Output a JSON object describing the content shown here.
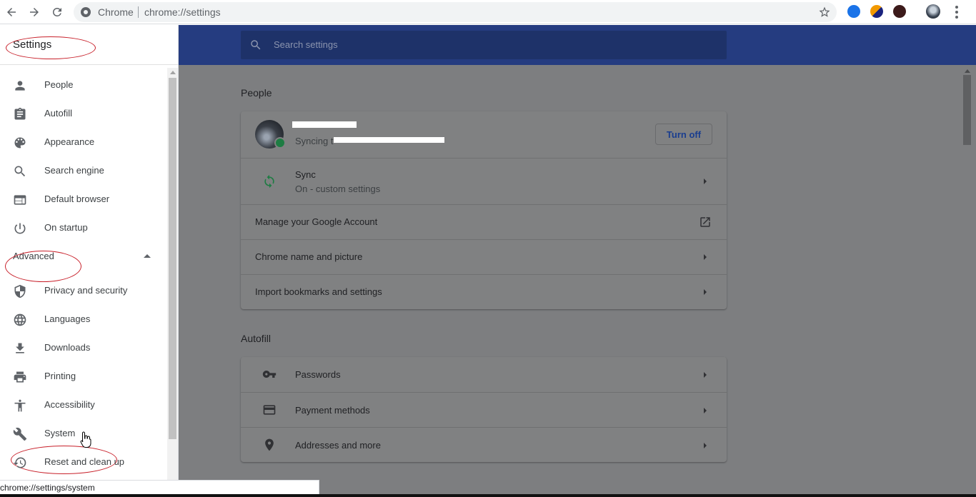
{
  "browser": {
    "site_label": "Chrome",
    "url": "chrome://settings",
    "status_url": "chrome://settings/system",
    "icons": [
      "back-icon",
      "forward-icon",
      "reload-icon",
      "star-icon",
      "menu-icon"
    ]
  },
  "sidebar": {
    "title": "Settings",
    "items": [
      {
        "label": "People",
        "icon": "person-icon"
      },
      {
        "label": "Autofill",
        "icon": "clipboard-icon"
      },
      {
        "label": "Appearance",
        "icon": "palette-icon"
      },
      {
        "label": "Search engine",
        "icon": "search-icon"
      },
      {
        "label": "Default browser",
        "icon": "browser-window-icon"
      },
      {
        "label": "On startup",
        "icon": "power-icon"
      }
    ],
    "advanced_label": "Advanced",
    "advanced_items": [
      {
        "label": "Privacy and security",
        "icon": "shield-icon"
      },
      {
        "label": "Languages",
        "icon": "globe-icon"
      },
      {
        "label": "Downloads",
        "icon": "download-icon"
      },
      {
        "label": "Printing",
        "icon": "printer-icon"
      },
      {
        "label": "Accessibility",
        "icon": "accessibility-icon"
      },
      {
        "label": "System",
        "icon": "wrench-icon"
      },
      {
        "label": "Reset and clean up",
        "icon": "history-icon"
      }
    ]
  },
  "search": {
    "placeholder": "Search settings"
  },
  "people": {
    "section_title": "People",
    "account": {
      "syncing_prefix": "Syncing t",
      "turn_off_label": "Turn off"
    },
    "sync": {
      "label": "Sync",
      "status": "On - custom settings"
    },
    "manage_account_label": "Manage your Google Account",
    "chrome_name_label": "Chrome name and picture",
    "import_label": "Import bookmarks and settings"
  },
  "autofill": {
    "section_title": "Autofill",
    "passwords_label": "Passwords",
    "payment_label": "Payment methods",
    "addresses_label": "Addresses and more"
  },
  "colors": {
    "header_blue": "#253c80",
    "annotation_red": "#c8202a",
    "overlay_gray": "#7d7e80"
  }
}
